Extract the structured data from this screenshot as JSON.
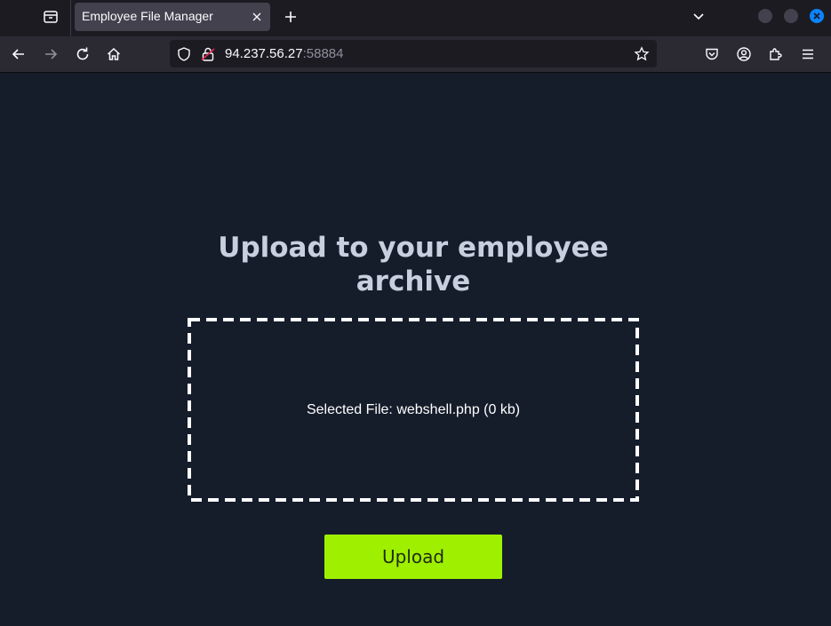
{
  "browser": {
    "tab": {
      "title": "Employee File Manager"
    },
    "address_bar": {
      "host": "94.237.56.27",
      "port": ":58884"
    }
  },
  "page": {
    "heading": "Upload to your employee archive",
    "dropzone": {
      "selected_file_text": "Selected File: webshell.php (0 kb)"
    },
    "upload_button_label": "Upload"
  },
  "colors": {
    "page_background": "#151d2b",
    "upload_button": "#9ff000",
    "heading_text": "#c8d0df",
    "close_window_button": "#0a84ff"
  }
}
